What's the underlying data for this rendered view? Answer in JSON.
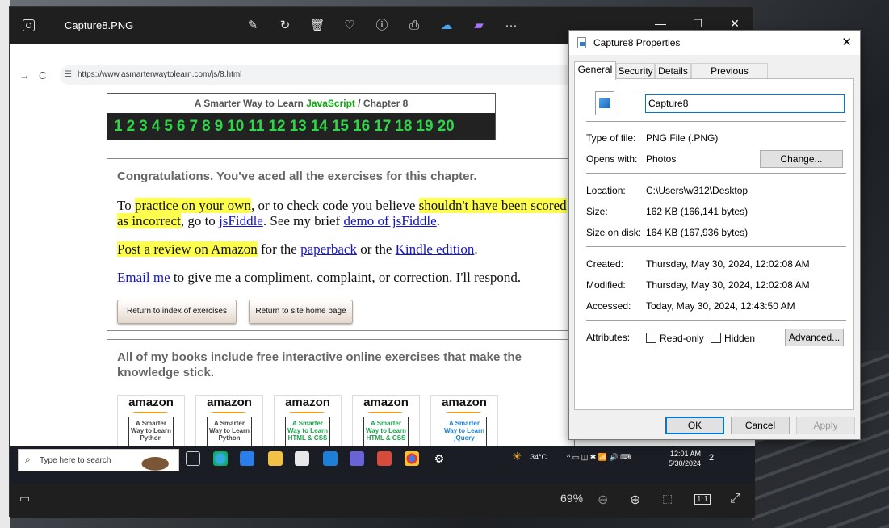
{
  "photos": {
    "filename": "Capture8.PNG",
    "toolbar": [
      "edit-icon",
      "rotate-icon",
      "delete-icon",
      "favorite-icon",
      "info-icon",
      "print-icon",
      "onedrive-icon",
      "clipchamp-icon",
      "more-icon"
    ],
    "more_glyph": "···",
    "window_controls": {
      "minimize": "—",
      "maximize": "☐",
      "close": "✕"
    },
    "zoom": "69%",
    "zoom_out_glyph": "⊖",
    "zoom_in_glyph": "⊕",
    "one_to_one": "1:1",
    "expand_glyph": "⤢",
    "filmstrip_glyph": "▭"
  },
  "browser": {
    "back": "→",
    "reload": "C",
    "url": "https://www.asmarterwaytolearn.com/js/8.html"
  },
  "page": {
    "nav_title_prefix": "A Smarter Way to Learn ",
    "nav_title_js": "JavaScript",
    "nav_title_suffix": " / Chapter 8",
    "chapters": [
      "1",
      "2",
      "3",
      "4",
      "5",
      "6",
      "7",
      "8",
      "9",
      "10",
      "11",
      "12",
      "13",
      "14",
      "15",
      "16",
      "17",
      "18",
      "19",
      "20"
    ],
    "congrats_title": "Congratulations. You've aced all the exercises for this chapter.",
    "p1": {
      "a": "To ",
      "hl1": "practice on your own",
      "b": ", or to check code you believe ",
      "hl2": "shouldn't have been scored as incorrect",
      "c": ", go to ",
      "link1": "jsFiddle",
      "d": ". See my brief ",
      "link2": "demo of jsFiddle",
      "e": "."
    },
    "p2": {
      "hl": "Post a review on Amazon",
      "a": " for the ",
      "link1": "paperback",
      "b": " or the ",
      "link2": "Kindle edition",
      "c": "."
    },
    "p3": {
      "link": "Email me",
      "a": " to give me a compliment, complaint, or correction. I'll respond."
    },
    "btn_index": "Return to index of exercises",
    "btn_home": "Return to site home page",
    "books_title": " All of my books include free interactive online exercises that make the knowledge stick.",
    "amazon": "amazon",
    "books": [
      {
        "title": "A Smarter Way to Learn Python",
        "color": "#444444"
      },
      {
        "title": "A Smarter Way to Learn Python",
        "color": "#444444"
      },
      {
        "title": "A Smarter Way to Learn HTML & CSS",
        "color": "#1aa34a"
      },
      {
        "title": "A Smarter Way to Learn HTML & CSS",
        "color": "#1aa34a"
      },
      {
        "title": "A Smarter Way to Learn jQuery",
        "color": "#1a7fd4"
      }
    ]
  },
  "taskbar": {
    "search_placeholder": "Type here to search",
    "temp": "34°C",
    "time": "12:01 AM",
    "date": "5/30/2024",
    "notif": "2"
  },
  "properties": {
    "title": "Capture8 Properties",
    "close": "✕",
    "tabs": [
      "General",
      "Security",
      "Details",
      "Previous Versions"
    ],
    "name": "Capture8",
    "type_label": "Type of file:",
    "type_value": "PNG File (.PNG)",
    "opens_label": "Opens with:",
    "opens_value": "Photos",
    "change": "Change...",
    "location_label": "Location:",
    "location_value": "C:\\Users\\w312\\Desktop",
    "size_label": "Size:",
    "size_value": "162 KB (166,141 bytes)",
    "sizeondisk_label": "Size on disk:",
    "sizeondisk_value": "164 KB (167,936 bytes)",
    "created_label": "Created:",
    "created_value": "Thursday, May 30, 2024, 12:02:08 AM",
    "modified_label": "Modified:",
    "modified_value": "Thursday, May 30, 2024, 12:02:08 AM",
    "accessed_label": "Accessed:",
    "accessed_value": "Today, May 30, 2024, 12:43:50 AM",
    "attributes_label": "Attributes:",
    "readonly": "Read-only",
    "hidden": "Hidden",
    "advanced": "Advanced...",
    "ok": "OK",
    "cancel": "Cancel",
    "apply": "Apply"
  }
}
